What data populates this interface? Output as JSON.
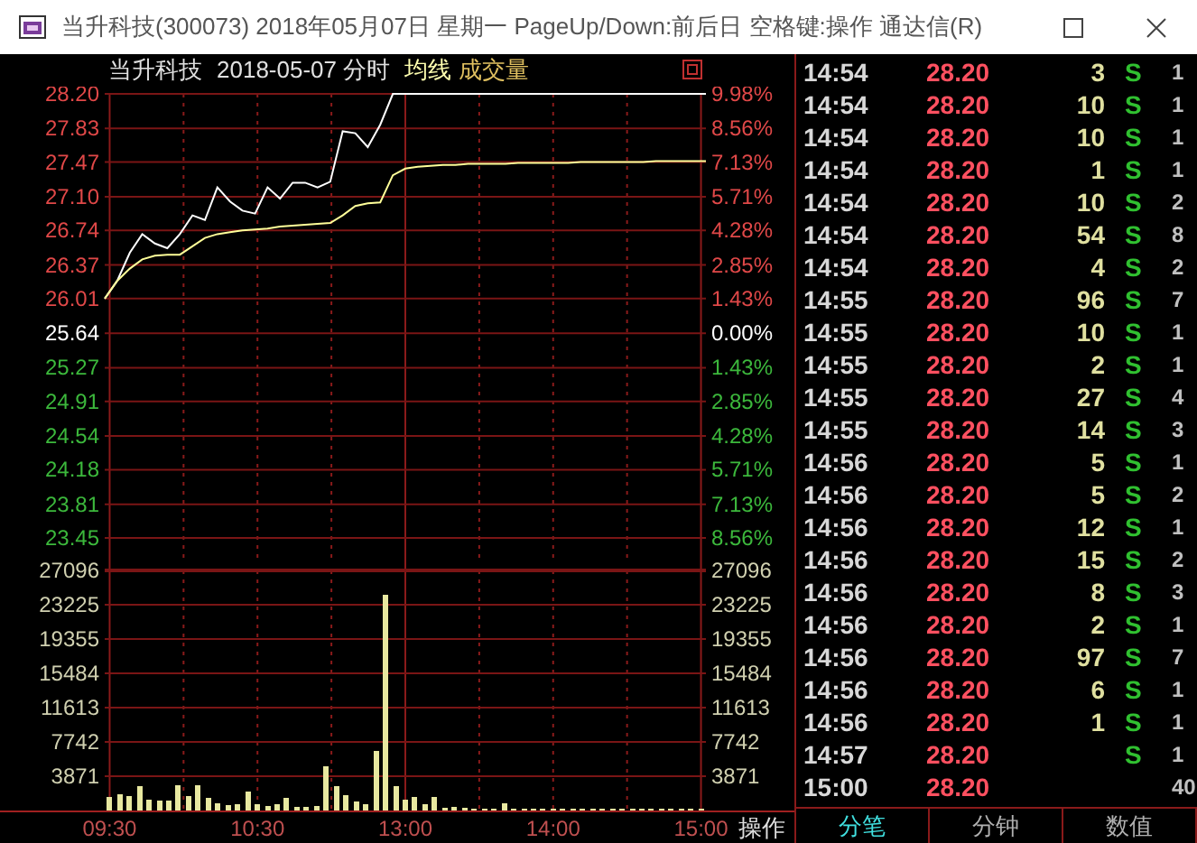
{
  "window": {
    "title": "当升科技(300073) 2018年05月07日 星期一 PageUp/Down:前后日 空格键:操作 通达信(R)"
  },
  "chart_header": {
    "stock": "当升科技",
    "date_mode": "2018-05-07 分时"
  },
  "price_chart": {
    "axis": [
      {
        "pct": "9.98%",
        "color": "#e04848"
      },
      {
        "pct": "8.56%",
        "color": "#e04848"
      },
      {
        "pct": "7.13%",
        "color": "#e04848"
      },
      {
        "pct": "5.71%",
        "color": "#e04848"
      },
      {
        "pct": "4.28%",
        "color": "#e04848"
      },
      {
        "pct": "2.85%",
        "color": "#e04848"
      },
      {
        "pct": "1.43%",
        "color": "#e04848"
      },
      {
        "pct": "0.00%",
        "color": "#ffffff"
      },
      {
        "pct": "1.43%",
        "color": "#3cb83c"
      },
      {
        "pct": "2.85%",
        "color": "#3cb83c"
      },
      {
        "pct": "4.28%",
        "color": "#3cb83c"
      },
      {
        "pct": "5.71%",
        "color": "#3cb83c"
      },
      {
        "pct": "7.13%",
        "color": "#3cb83c"
      },
      {
        "pct": "8.56%",
        "color": "#3cb83c"
      }
    ],
    "chart_data": {
      "type": "line",
      "categories": [
        null,
        null,
        null,
        null,
        null,
        null,
        null,
        null,
        null,
        null,
        null,
        null,
        null,
        null,
        null,
        null,
        null,
        null,
        null,
        null,
        null,
        null,
        null,
        null,
        null,
        null,
        null,
        null,
        null,
        null,
        null,
        null,
        null,
        null,
        null,
        null,
        null,
        null,
        null,
        null,
        null,
        null,
        null,
        null,
        null,
        null,
        null,
        null,
        null
      ],
      "series": [
        {
          "color": "#ffffff",
          "values": [
            26.01,
            26.2,
            26.5,
            26.7,
            26.6,
            26.55,
            26.7,
            26.9,
            26.85,
            27.2,
            27.05,
            26.95,
            26.92,
            27.2,
            27.08,
            27.25,
            27.25,
            27.2,
            27.26,
            27.8,
            27.78,
            27.63,
            27.87,
            28.2,
            28.2,
            28.2,
            28.2,
            28.2,
            28.2,
            28.2,
            28.2,
            28.2,
            28.2,
            28.2,
            28.2,
            28.2,
            28.2,
            28.2,
            28.2,
            28.2,
            28.2,
            28.2,
            28.2,
            28.2,
            28.2,
            28.2,
            28.2,
            28.2,
            28.2
          ]
        },
        {
          "name": "均线",
          "color": "#ffff99",
          "values": [
            26.01,
            26.2,
            26.33,
            26.43,
            26.47,
            26.48,
            26.48,
            26.57,
            26.66,
            26.7,
            26.72,
            26.74,
            26.75,
            26.76,
            26.78,
            26.79,
            26.8,
            26.81,
            26.82,
            26.9,
            27.0,
            27.03,
            27.04,
            27.33,
            27.4,
            27.42,
            27.43,
            27.44,
            27.44,
            27.45,
            27.45,
            27.45,
            27.45,
            27.46,
            27.46,
            27.46,
            27.46,
            27.46,
            27.47,
            27.47,
            27.47,
            27.47,
            27.47,
            27.47,
            27.48,
            27.48,
            27.48,
            27.48,
            27.48
          ]
        }
      ],
      "ylim": [
        23.45,
        28.2
      ],
      "grid": true,
      "yticks": [
        {
          "value": 28.2,
          "label": "28.20"
        },
        {
          "value": 27.83,
          "label": "27.83"
        },
        {
          "value": 27.47,
          "label": "27.47"
        },
        {
          "value": 27.1,
          "label": "27.10"
        },
        {
          "value": 26.74,
          "label": "26.74"
        },
        {
          "value": 26.37,
          "label": "26.37"
        },
        {
          "value": 26.01,
          "label": "26.01"
        },
        {
          "value": 25.64,
          "label": "25.64"
        },
        {
          "value": 25.27,
          "label": "25.27"
        },
        {
          "value": 24.91,
          "label": "24.91"
        },
        {
          "value": 24.54,
          "label": "24.54"
        },
        {
          "value": 24.18,
          "label": "24.18"
        },
        {
          "value": 23.81,
          "label": "23.81"
        },
        {
          "value": 23.45,
          "label": "23.45"
        }
      ]
    }
  },
  "volume_chart": {
    "right_axis": [
      "27096",
      "23225",
      "19355",
      "15484",
      "11613",
      "7742",
      "3871"
    ],
    "chart_data": {
      "type": "bar",
      "categories": [
        "09:30",
        null,
        null,
        null,
        null,
        null,
        null,
        null,
        null,
        null,
        null,
        null,
        null,
        null,
        null,
        "10:30",
        null,
        null,
        null,
        null,
        null,
        null,
        null,
        null,
        null,
        null,
        null,
        null,
        null,
        null,
        "13:00",
        null,
        null,
        null,
        null,
        null,
        null,
        null,
        null,
        null,
        null,
        null,
        null,
        null,
        null,
        "14:00",
        null,
        null,
        null,
        null,
        null,
        null,
        null,
        null,
        null,
        null,
        null,
        null,
        null,
        null,
        "15:00"
      ],
      "series": [
        {
          "name": "成交量",
          "color": "#e8e8a0",
          "values": [
            1500,
            1800,
            1600,
            2800,
            1200,
            1100,
            1100,
            2900,
            1600,
            2900,
            1400,
            800,
            600,
            700,
            2100,
            700,
            500,
            700,
            1400,
            400,
            400,
            500,
            5000,
            2800,
            1700,
            1000,
            700,
            6700,
            24300,
            2700,
            1200,
            1500,
            700,
            1500,
            300,
            400,
            300,
            200,
            200,
            200,
            800,
            200,
            200,
            200,
            200,
            200,
            200,
            200,
            200,
            200,
            200,
            200,
            200,
            200,
            200,
            200,
            200,
            200,
            200,
            200,
            200
          ]
        }
      ],
      "ylim": [
        0,
        27096
      ],
      "grid": true,
      "yticks": [
        {
          "value": 27096,
          "label": "27096"
        },
        {
          "value": 23225,
          "label": "23225"
        },
        {
          "value": 19355,
          "label": "19355"
        },
        {
          "value": 15484,
          "label": "15484"
        },
        {
          "value": 11613,
          "label": "11613"
        },
        {
          "value": 7742,
          "label": "7742"
        },
        {
          "value": 3871,
          "label": "3871"
        }
      ]
    }
  },
  "operate_tab": "操作",
  "ticks": [
    {
      "time": "14:54",
      "price": "28.20",
      "volume": "3",
      "side": "S",
      "column_5": "1"
    },
    {
      "time": "14:54",
      "price": "28.20",
      "volume": "10",
      "side": "S",
      "column_5": "1"
    },
    {
      "time": "14:54",
      "price": "28.20",
      "volume": "10",
      "side": "S",
      "column_5": "1"
    },
    {
      "time": "14:54",
      "price": "28.20",
      "volume": "1",
      "side": "S",
      "column_5": "1"
    },
    {
      "time": "14:54",
      "price": "28.20",
      "volume": "10",
      "side": "S",
      "column_5": "2"
    },
    {
      "time": "14:54",
      "price": "28.20",
      "volume": "54",
      "side": "S",
      "column_5": "8"
    },
    {
      "time": "14:54",
      "price": "28.20",
      "volume": "4",
      "side": "S",
      "column_5": "2"
    },
    {
      "time": "14:55",
      "price": "28.20",
      "volume": "96",
      "side": "S",
      "column_5": "7"
    },
    {
      "time": "14:55",
      "price": "28.20",
      "volume": "10",
      "side": "S",
      "column_5": "1"
    },
    {
      "time": "14:55",
      "price": "28.20",
      "volume": "2",
      "side": "S",
      "column_5": "1"
    },
    {
      "time": "14:55",
      "price": "28.20",
      "volume": "27",
      "side": "S",
      "column_5": "4"
    },
    {
      "time": "14:55",
      "price": "28.20",
      "volume": "14",
      "side": "S",
      "column_5": "3"
    },
    {
      "time": "14:56",
      "price": "28.20",
      "volume": "5",
      "side": "S",
      "column_5": "1"
    },
    {
      "time": "14:56",
      "price": "28.20",
      "volume": "5",
      "side": "S",
      "column_5": "2"
    },
    {
      "time": "14:56",
      "price": "28.20",
      "volume": "12",
      "side": "S",
      "column_5": "1"
    },
    {
      "time": "14:56",
      "price": "28.20",
      "volume": "15",
      "side": "S",
      "column_5": "2"
    },
    {
      "time": "14:56",
      "price": "28.20",
      "volume": "8",
      "side": "S",
      "column_5": "3"
    },
    {
      "time": "14:56",
      "price": "28.20",
      "volume": "2",
      "side": "S",
      "column_5": "1"
    },
    {
      "time": "14:56",
      "price": "28.20",
      "volume": "97",
      "side": "S",
      "column_5": "7"
    },
    {
      "time": "14:56",
      "price": "28.20",
      "volume": "6",
      "side": "S",
      "column_5": "1"
    },
    {
      "time": "14:56",
      "price": "28.20",
      "volume": "1",
      "side": "S",
      "column_5": "1"
    },
    {
      "time": "14:57",
      "price": "28.20",
      "side": "S",
      "column_5": "1"
    },
    {
      "time": "15:00",
      "price": "28.20",
      "column_5": "40"
    }
  ],
  "tabs": [
    {
      "label": "分笔",
      "selected": true
    },
    {
      "label": "分钟",
      "selected": false
    },
    {
      "label": "数值",
      "selected": false
    }
  ]
}
